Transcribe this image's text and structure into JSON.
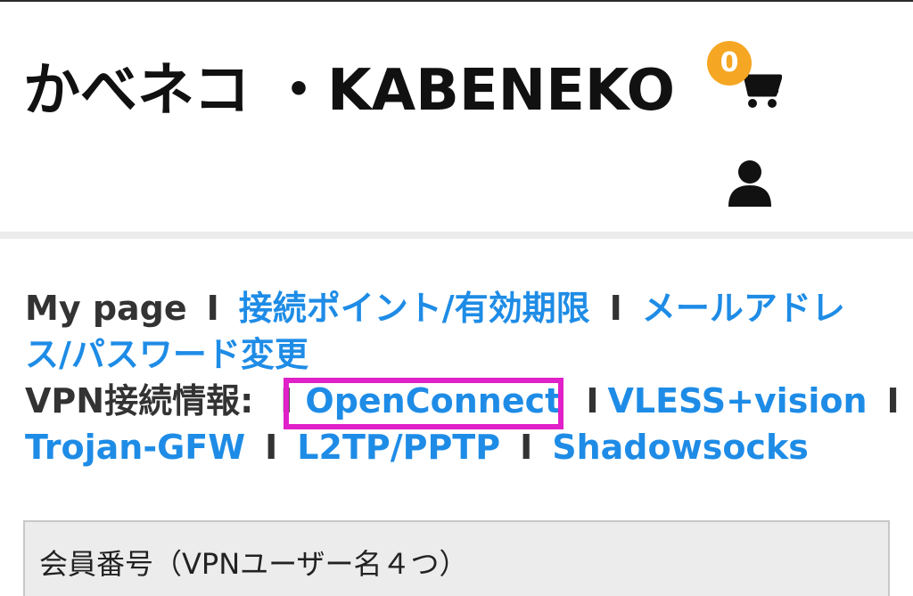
{
  "header": {
    "title": "かべネコ ・KABENEKO",
    "cart_count": "0",
    "cart_icon": "cart-icon",
    "user_icon": "user-icon"
  },
  "nav": {
    "mypage": "My page",
    "separator": "I",
    "links_line1": [
      "接続ポイント/有効期限",
      "メールアドレ"
    ],
    "link_line2": "ス/パスワード変更",
    "vpn_label": "VPN接続情報:",
    "vpn_links": [
      "OpenConnect",
      "VLESS+vision",
      "Trojan-GFW",
      "L2TP/PPTP",
      "Shadowsocks"
    ]
  },
  "member": {
    "label": "会員番号（VPNユーザー名４つ）"
  },
  "colors": {
    "link": "#1e8ce6",
    "badge": "#f5a623",
    "highlight": "#e020c8"
  }
}
